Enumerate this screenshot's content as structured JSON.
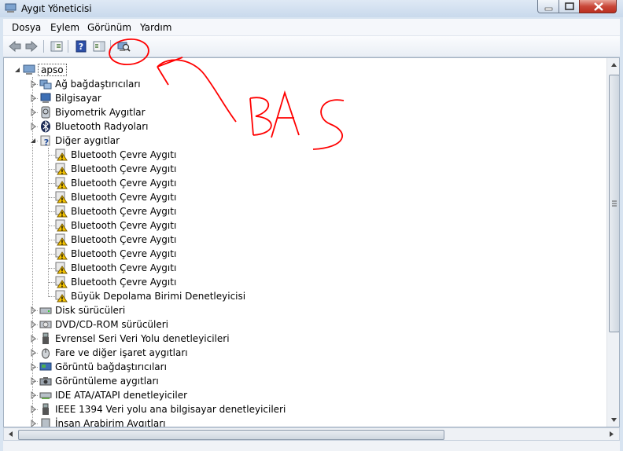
{
  "window": {
    "title": "Aygıt Yöneticisi"
  },
  "menu": [
    "Dosya",
    "Eylem",
    "Görünüm",
    "Yardım"
  ],
  "toolbar": {
    "buttons": [
      "back-arrow-icon",
      "forward-arrow-icon",
      "properties-icon",
      "help-icon",
      "console-tree-icon",
      "scan-hardware-icon"
    ]
  },
  "tree": {
    "root": "apso",
    "categories": [
      {
        "label": "Ağ bağdaştırıcıları",
        "icon": "network-icon"
      },
      {
        "label": "Bilgisayar",
        "icon": "computer-icon"
      },
      {
        "label": "Biyometrik Aygıtlar",
        "icon": "biometric-icon"
      },
      {
        "label": "Bluetooth Radyoları",
        "icon": "bluetooth-icon"
      },
      {
        "label": "Diğer aygıtlar",
        "icon": "unknown-device-icon",
        "expanded": true,
        "children": [
          "Bluetooth Çevre Aygıtı",
          "Bluetooth Çevre Aygıtı",
          "Bluetooth Çevre Aygıtı",
          "Bluetooth Çevre Aygıtı",
          "Bluetooth Çevre Aygıtı",
          "Bluetooth Çevre Aygıtı",
          "Bluetooth Çevre Aygıtı",
          "Bluetooth Çevre Aygıtı",
          "Bluetooth Çevre Aygıtı",
          "Bluetooth Çevre Aygıtı",
          "Büyük Depolama Birimi Denetleyicisi"
        ]
      },
      {
        "label": "Disk sürücüleri",
        "icon": "disk-drive-icon"
      },
      {
        "label": "DVD/CD-ROM sürücüleri",
        "icon": "dvd-drive-icon"
      },
      {
        "label": "Evrensel Seri Veri Yolu denetleyicileri",
        "icon": "usb-icon"
      },
      {
        "label": "Fare ve diğer işaret aygıtları",
        "icon": "mouse-icon"
      },
      {
        "label": "Görüntü bağdaştırıcıları",
        "icon": "display-adapter-icon"
      },
      {
        "label": "Görüntüleme aygıtları",
        "icon": "imaging-device-icon"
      },
      {
        "label": "IDE ATA/ATAPI denetleyiciler",
        "icon": "ide-controller-icon"
      },
      {
        "label": "IEEE 1394 Veri yolu ana bilgisayar denetleyicileri",
        "icon": "firewire-icon"
      },
      {
        "label": "İnsan Arabirim Aygıtları",
        "icon": "hid-icon"
      }
    ]
  },
  "annotation": {
    "text": "BAS",
    "color": "#ff0000"
  }
}
